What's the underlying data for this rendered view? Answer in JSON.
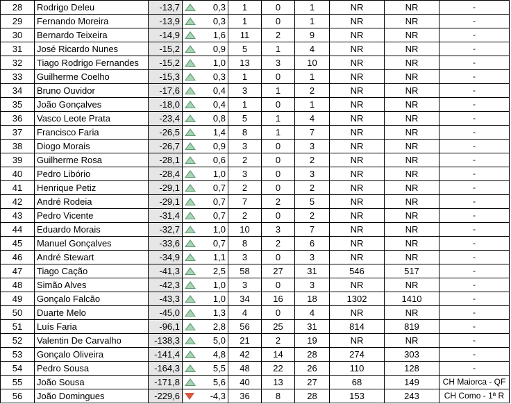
{
  "rows": [
    {
      "rank": "28",
      "name": "Rodrigo Deleu",
      "score": "-13,7",
      "trend": "up",
      "delta": "0,3",
      "c1": "1",
      "c2": "0",
      "c3": "1",
      "r1": "NR",
      "r2": "NR",
      "note": "-"
    },
    {
      "rank": "29",
      "name": "Fernando Moreira",
      "score": "-13,9",
      "trend": "up",
      "delta": "0,3",
      "c1": "1",
      "c2": "0",
      "c3": "1",
      "r1": "NR",
      "r2": "NR",
      "note": "-"
    },
    {
      "rank": "30",
      "name": "Bernardo Teixeira",
      "score": "-14,9",
      "trend": "up",
      "delta": "1,6",
      "c1": "11",
      "c2": "2",
      "c3": "9",
      "r1": "NR",
      "r2": "NR",
      "note": "-"
    },
    {
      "rank": "31",
      "name": "José Ricardo Nunes",
      "score": "-15,2",
      "trend": "up",
      "delta": "0,9",
      "c1": "5",
      "c2": "1",
      "c3": "4",
      "r1": "NR",
      "r2": "NR",
      "note": "-"
    },
    {
      "rank": "32",
      "name": "Tiago Rodrigo Fernandes",
      "score": "-15,2",
      "trend": "up",
      "delta": "1,0",
      "c1": "13",
      "c2": "3",
      "c3": "10",
      "r1": "NR",
      "r2": "NR",
      "note": "-"
    },
    {
      "rank": "33",
      "name": "Guilherme Coelho",
      "score": "-15,3",
      "trend": "up",
      "delta": "0,3",
      "c1": "1",
      "c2": "0",
      "c3": "1",
      "r1": "NR",
      "r2": "NR",
      "note": "-"
    },
    {
      "rank": "34",
      "name": "Bruno Ouvidor",
      "score": "-17,6",
      "trend": "up",
      "delta": "0,4",
      "c1": "3",
      "c2": "1",
      "c3": "2",
      "r1": "NR",
      "r2": "NR",
      "note": "-"
    },
    {
      "rank": "35",
      "name": "João Gonçalves",
      "score": "-18,0",
      "trend": "up",
      "delta": "0,4",
      "c1": "1",
      "c2": "0",
      "c3": "1",
      "r1": "NR",
      "r2": "NR",
      "note": "-"
    },
    {
      "rank": "36",
      "name": "Vasco Leote Prata",
      "score": "-23,4",
      "trend": "up",
      "delta": "0,8",
      "c1": "5",
      "c2": "1",
      "c3": "4",
      "r1": "NR",
      "r2": "NR",
      "note": "-"
    },
    {
      "rank": "37",
      "name": "Francisco Faria",
      "score": "-26,5",
      "trend": "up",
      "delta": "1,4",
      "c1": "8",
      "c2": "1",
      "c3": "7",
      "r1": "NR",
      "r2": "NR",
      "note": "-"
    },
    {
      "rank": "38",
      "name": "Diogo Morais",
      "score": "-26,7",
      "trend": "up",
      "delta": "0,9",
      "c1": "3",
      "c2": "0",
      "c3": "3",
      "r1": "NR",
      "r2": "NR",
      "note": "-"
    },
    {
      "rank": "39",
      "name": "Guilherme Rosa",
      "score": "-28,1",
      "trend": "up",
      "delta": "0,6",
      "c1": "2",
      "c2": "0",
      "c3": "2",
      "r1": "NR",
      "r2": "NR",
      "note": "-"
    },
    {
      "rank": "40",
      "name": "Pedro Libório",
      "score": "-28,4",
      "trend": "up",
      "delta": "1,0",
      "c1": "3",
      "c2": "0",
      "c3": "3",
      "r1": "NR",
      "r2": "NR",
      "note": "-"
    },
    {
      "rank": "41",
      "name": "Henrique Petiz",
      "score": "-29,1",
      "trend": "up",
      "delta": "0,7",
      "c1": "2",
      "c2": "0",
      "c3": "2",
      "r1": "NR",
      "r2": "NR",
      "note": "-"
    },
    {
      "rank": "42",
      "name": "André Rodeia",
      "score": "-29,1",
      "trend": "up",
      "delta": "0,7",
      "c1": "7",
      "c2": "2",
      "c3": "5",
      "r1": "NR",
      "r2": "NR",
      "note": "-"
    },
    {
      "rank": "43",
      "name": "Pedro Vicente",
      "score": "-31,4",
      "trend": "up",
      "delta": "0,7",
      "c1": "2",
      "c2": "0",
      "c3": "2",
      "r1": "NR",
      "r2": "NR",
      "note": "-"
    },
    {
      "rank": "44",
      "name": "Eduardo Morais",
      "score": "-32,7",
      "trend": "up",
      "delta": "1,0",
      "c1": "10",
      "c2": "3",
      "c3": "7",
      "r1": "NR",
      "r2": "NR",
      "note": "-"
    },
    {
      "rank": "45",
      "name": "Manuel Gonçalves",
      "score": "-33,6",
      "trend": "up",
      "delta": "0,7",
      "c1": "8",
      "c2": "2",
      "c3": "6",
      "r1": "NR",
      "r2": "NR",
      "note": "-"
    },
    {
      "rank": "46",
      "name": "André Stewart",
      "score": "-34,9",
      "trend": "up",
      "delta": "1,1",
      "c1": "3",
      "c2": "0",
      "c3": "3",
      "r1": "NR",
      "r2": "NR",
      "note": "-"
    },
    {
      "rank": "47",
      "name": "Tiago Cação",
      "score": "-41,3",
      "trend": "up",
      "delta": "2,5",
      "c1": "58",
      "c2": "27",
      "c3": "31",
      "r1": "546",
      "r2": "517",
      "note": "-"
    },
    {
      "rank": "48",
      "name": "Simão Alves",
      "score": "-42,3",
      "trend": "up",
      "delta": "1,0",
      "c1": "3",
      "c2": "0",
      "c3": "3",
      "r1": "NR",
      "r2": "NR",
      "note": "-"
    },
    {
      "rank": "49",
      "name": "Gonçalo Falcão",
      "score": "-43,3",
      "trend": "up",
      "delta": "1,0",
      "c1": "34",
      "c2": "16",
      "c3": "18",
      "r1": "1302",
      "r2": "1410",
      "note": "-"
    },
    {
      "rank": "50",
      "name": "Duarte Melo",
      "score": "-45,0",
      "trend": "up",
      "delta": "1,3",
      "c1": "4",
      "c2": "0",
      "c3": "4",
      "r1": "NR",
      "r2": "NR",
      "note": "-"
    },
    {
      "rank": "51",
      "name": "Luís Faria",
      "score": "-96,1",
      "trend": "up",
      "delta": "2,8",
      "c1": "56",
      "c2": "25",
      "c3": "31",
      "r1": "814",
      "r2": "819",
      "note": "-"
    },
    {
      "rank": "52",
      "name": "Valentin De Carvalho",
      "score": "-138,3",
      "trend": "up",
      "delta": "5,0",
      "c1": "21",
      "c2": "2",
      "c3": "19",
      "r1": "NR",
      "r2": "NR",
      "note": "-"
    },
    {
      "rank": "53",
      "name": "Gonçalo Oliveira",
      "score": "-141,4",
      "trend": "up",
      "delta": "4,8",
      "c1": "42",
      "c2": "14",
      "c3": "28",
      "r1": "274",
      "r2": "303",
      "note": "-"
    },
    {
      "rank": "54",
      "name": "Pedro Sousa",
      "score": "-164,3",
      "trend": "up",
      "delta": "5,5",
      "c1": "48",
      "c2": "22",
      "c3": "26",
      "r1": "110",
      "r2": "128",
      "note": "-"
    },
    {
      "rank": "55",
      "name": "João Sousa",
      "score": "-171,8",
      "trend": "up",
      "delta": "5,6",
      "c1": "40",
      "c2": "13",
      "c3": "27",
      "r1": "68",
      "r2": "149",
      "note": "CH Maiorca - QF"
    },
    {
      "rank": "56",
      "name": "João Domingues",
      "score": "-229,6",
      "trend": "down",
      "delta": "-4,3",
      "c1": "36",
      "c2": "8",
      "c3": "28",
      "r1": "153",
      "r2": "243",
      "note": "CH Como - 1ª R"
    }
  ],
  "colors": {
    "up_triangle": "#5a9b72",
    "down_triangle": "#d9573e",
    "score_bg": "#e6e6e6"
  },
  "icons": {
    "up": "triangle-up-icon",
    "down": "triangle-down-icon"
  }
}
